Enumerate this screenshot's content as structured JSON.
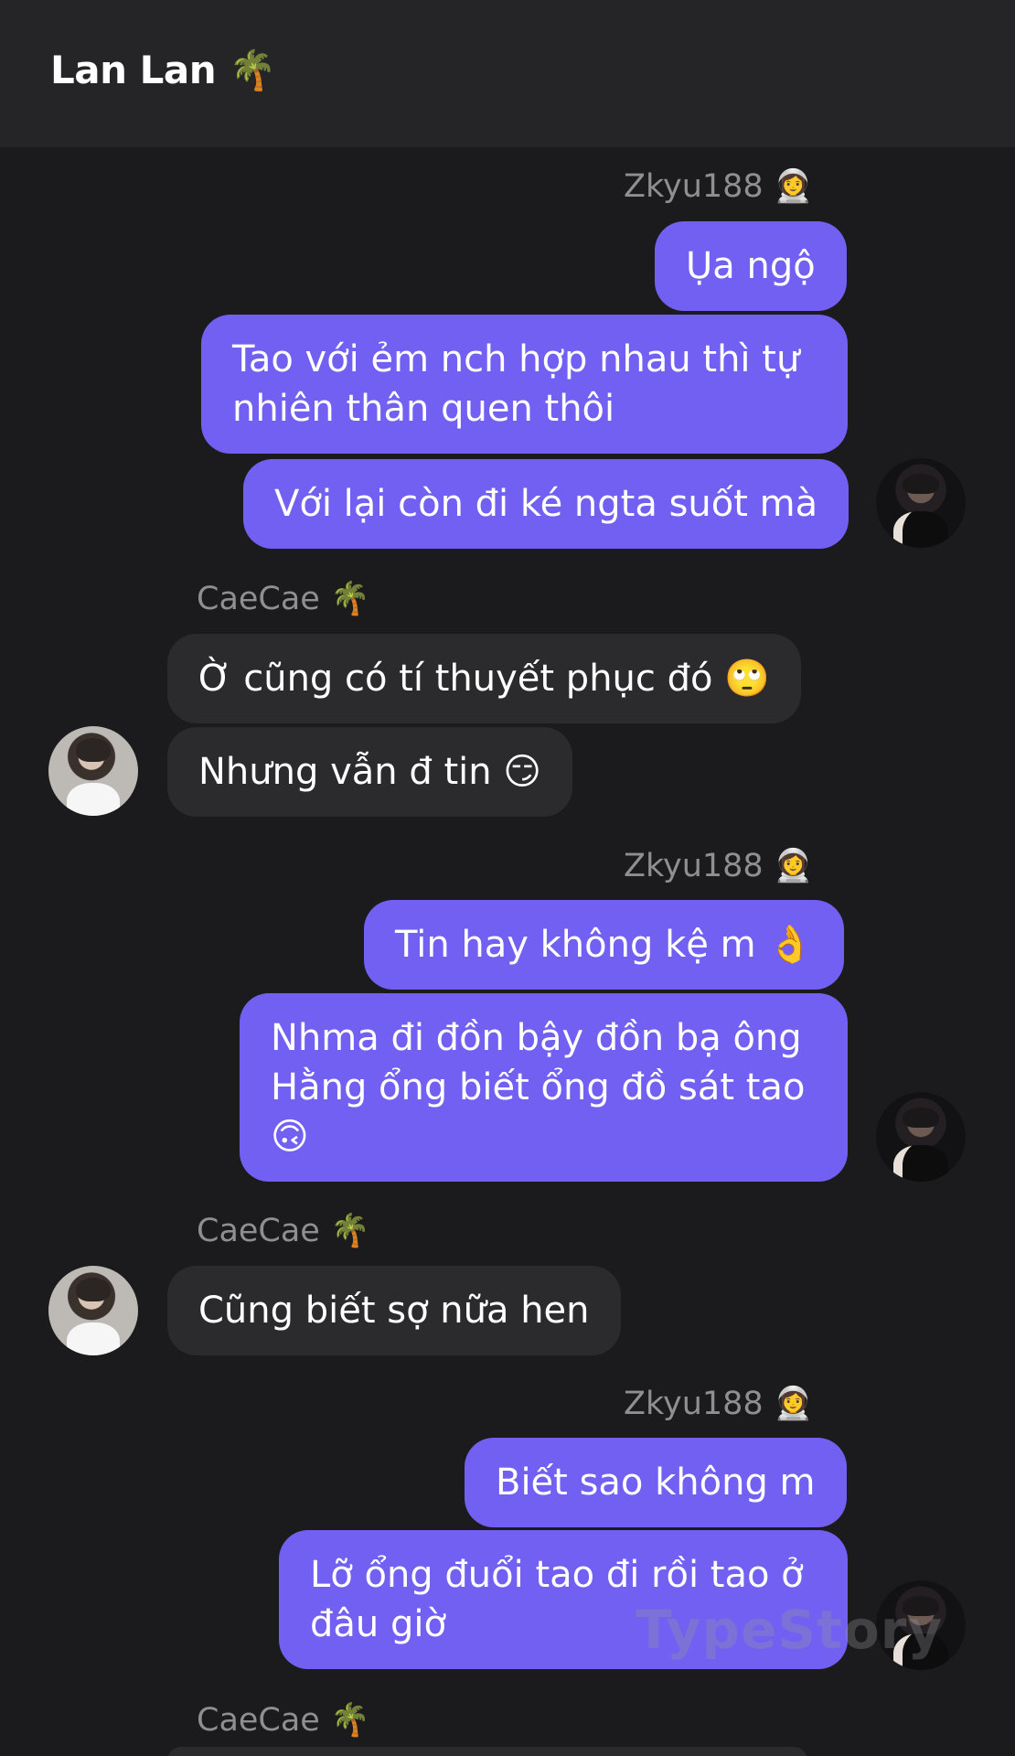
{
  "header": {
    "title": "Lan Lan 🌴"
  },
  "groups": [
    {
      "sender": "Zkyu188 👩‍🚀",
      "messages": [
        "Ụa ngộ",
        "Tao với ẻm nch hợp nhau thì tự nhiên thân quen thôi",
        "Với lại còn đi ké ngta suốt mà"
      ]
    },
    {
      "sender": "CaeCae 🌴",
      "messages": [
        "Ờ cũng có tí thuyết phục đó 🙄",
        "Nhưng vẫn đ tin 😏"
      ]
    },
    {
      "sender": "Zkyu188 👩‍🚀",
      "messages": [
        "Tin hay không kệ m 👌",
        "Nhma đi đồn bậy đồn bạ ông Hằng ổng biết ổng đồ sát tao 🙃"
      ]
    },
    {
      "sender": "CaeCae 🌴",
      "messages": [
        "Cũng biết sợ nữa hen"
      ]
    },
    {
      "sender": "Zkyu188 👩‍🚀",
      "messages": [
        "Biết sao không m",
        "Lỡ ổng đuổi tao đi rồi tao ở đâu giờ"
      ]
    },
    {
      "sender": "CaeCae 🌴",
      "messages": []
    }
  ],
  "watermark": "TypeStory",
  "colors": {
    "background": "#1b1b1d",
    "header": "#252527",
    "outgoing": "#7160f2",
    "incoming": "#2b2b2e",
    "sender": "#8e8e93"
  }
}
